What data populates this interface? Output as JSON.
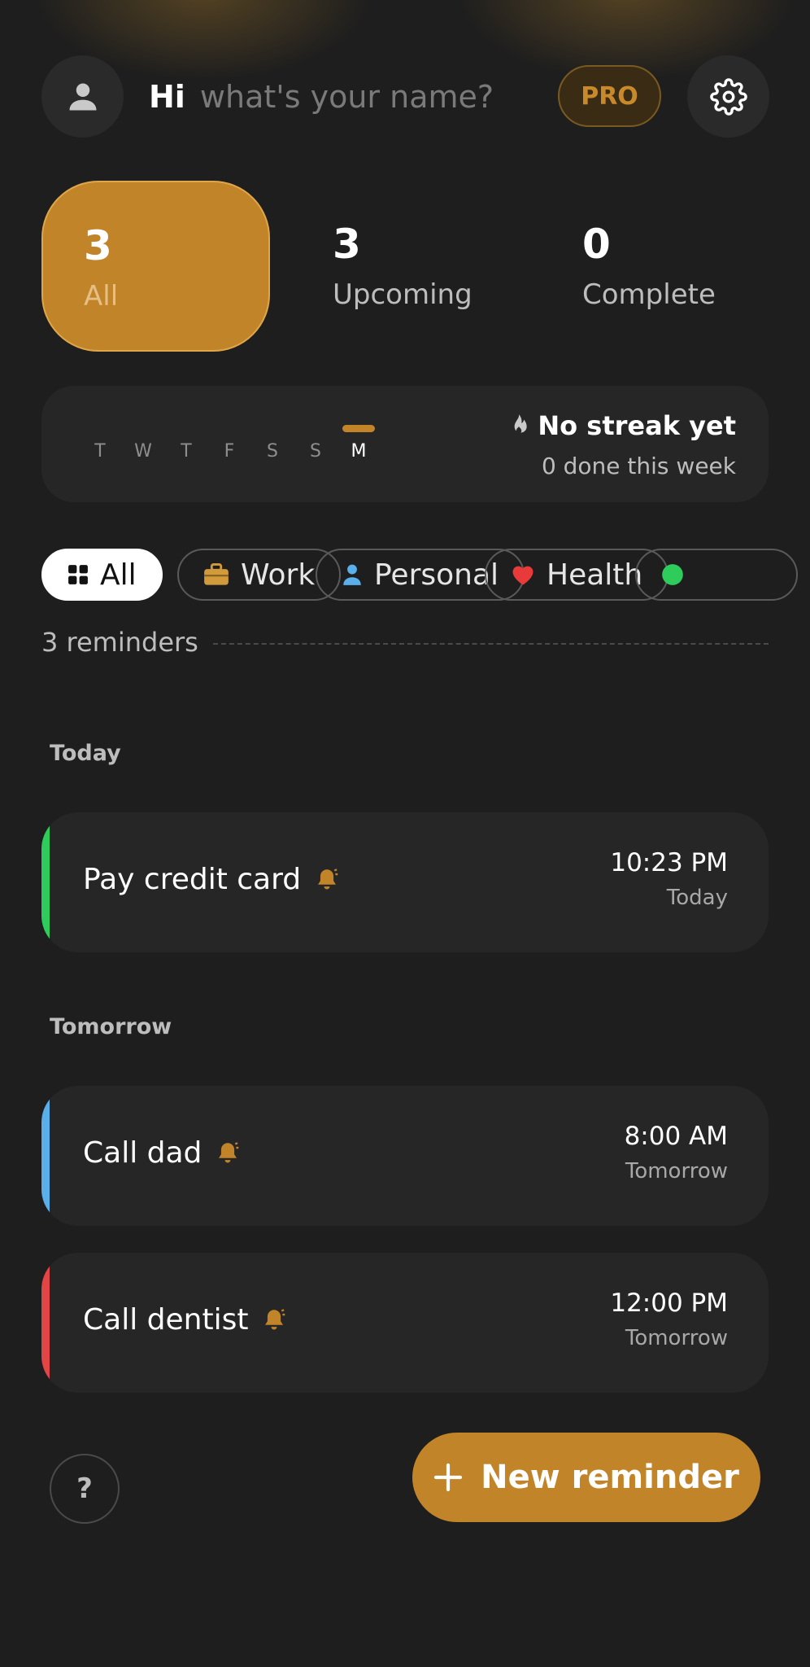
{
  "header": {
    "greeting": "Hi",
    "name_placeholder": "what's your name?",
    "pro_label": "PRO"
  },
  "stats": [
    {
      "value": "3",
      "label": "All"
    },
    {
      "value": "3",
      "label": "Upcoming"
    },
    {
      "value": "0",
      "label": "Complete"
    }
  ],
  "streak": {
    "days": [
      "T",
      "W",
      "T",
      "F",
      "S",
      "S",
      "M"
    ],
    "active_day_index": 6,
    "title": "No streak yet",
    "subtitle": "0 done this week"
  },
  "filters": [
    {
      "label": "All",
      "icon": "grid-icon",
      "selected": true
    },
    {
      "label": "Work",
      "icon": "briefcase-icon",
      "selected": false
    },
    {
      "label": "Personal",
      "icon": "person-icon",
      "selected": false
    },
    {
      "label": "Health",
      "icon": "heart-icon",
      "selected": false
    }
  ],
  "count_text": "3 reminders",
  "sections": [
    {
      "label": "Today",
      "items": [
        {
          "title": "Pay credit card",
          "time": "10:23 PM",
          "when": "Today",
          "accent": "#2ecc5a"
        }
      ]
    },
    {
      "label": "Tomorrow",
      "items": [
        {
          "title": "Call dad",
          "time": "8:00 AM",
          "when": "Tomorrow",
          "accent": "#5aaeea"
        },
        {
          "title": "Call dentist",
          "time": "12:00 PM",
          "when": "Tomorrow",
          "accent": "#e14545"
        }
      ]
    }
  ],
  "help_label": "?",
  "new_button_label": "New reminder",
  "colors": {
    "accent": "#c28428",
    "background": "#1e1e1e",
    "card": "#262626"
  }
}
